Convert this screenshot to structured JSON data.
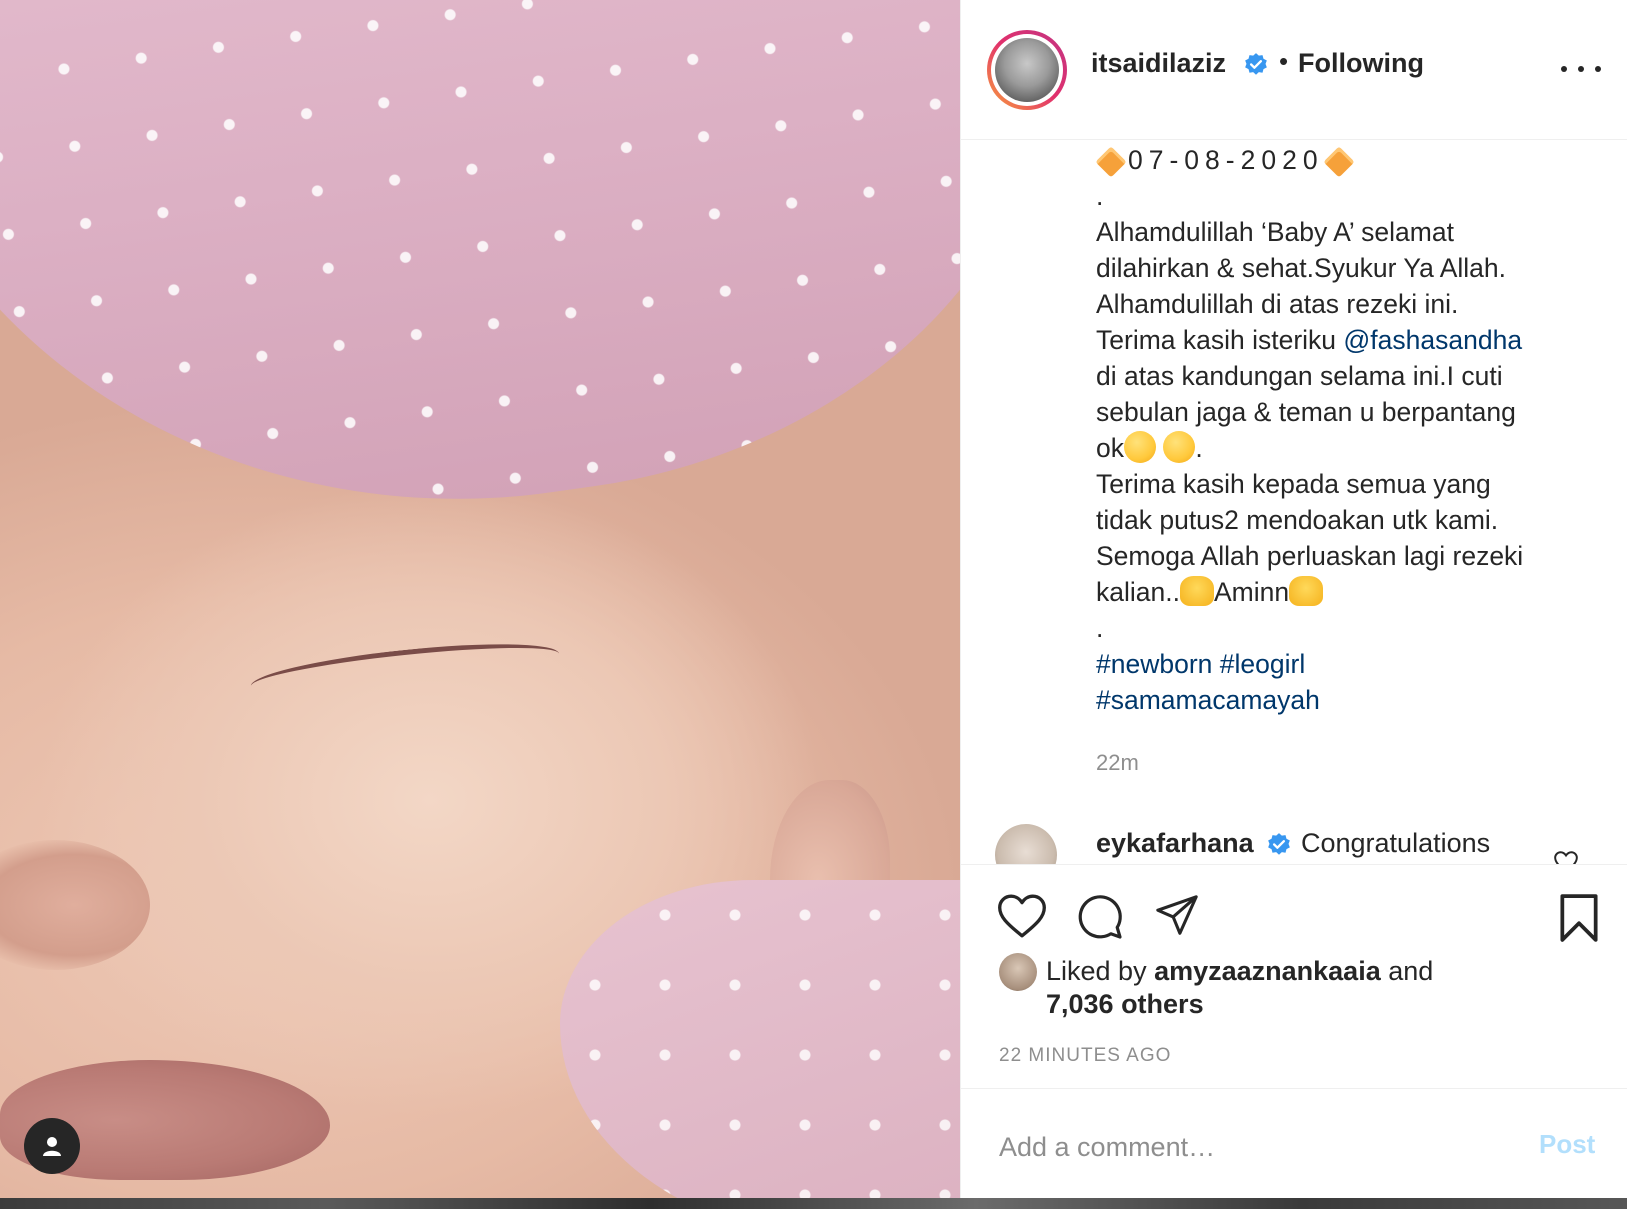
{
  "post": {
    "author": "itsaidilaziz",
    "follow_status": "Following",
    "separator": "•",
    "caption": {
      "date": "07-08-2020",
      "dot1": ".",
      "lines": [
        "Alhamdulillah ‘Baby A’ selamat",
        "dilahirkan & sehat.Syukur Ya Allah.",
        "Alhamdulillah di atas rezeki ini."
      ],
      "mention_prefix": "Terima kasih isteriku ",
      "mention": "@fashasandha",
      "lines2": [
        "di atas kandungan selama ini.I cuti",
        "sebulan jaga & teman u berpantang"
      ],
      "ok_text": "ok",
      "ok_suffix": ".",
      "lines3": [
        "Terima kasih kepada semua yang",
        "tidak putus2 mendoakan utk kami.",
        "Semoga Allah perluaskan lagi rezeki"
      ],
      "kalian": "kalian..",
      "aminn": "Aminn",
      "dot2": ".",
      "hashtags_line1": [
        "#newborn",
        "#leogirl"
      ],
      "hashtags_line2": [
        "#samamacamayah"
      ]
    },
    "caption_time": "22m"
  },
  "first_comment": {
    "user": "eykafarhana",
    "text": "Congratulations"
  },
  "likes": {
    "prefix": "Liked by ",
    "user": "amyzaaznankaaia",
    "conjunction": " and",
    "others": "7,036 others"
  },
  "posted_ago": "22 MINUTES AGO",
  "comment_input": {
    "placeholder": "Add a comment…",
    "post_label": "Post"
  },
  "colors": {
    "link": "#00376b",
    "verified": "#3897f0",
    "muted": "#8e8e8e",
    "post_disabled": "#b2dffc"
  },
  "icons": {
    "tag_people": "user-icon",
    "like": "heart-icon",
    "comment": "comment-icon",
    "share": "paper-plane-icon",
    "save": "bookmark-icon",
    "more": "more-options-icon"
  }
}
